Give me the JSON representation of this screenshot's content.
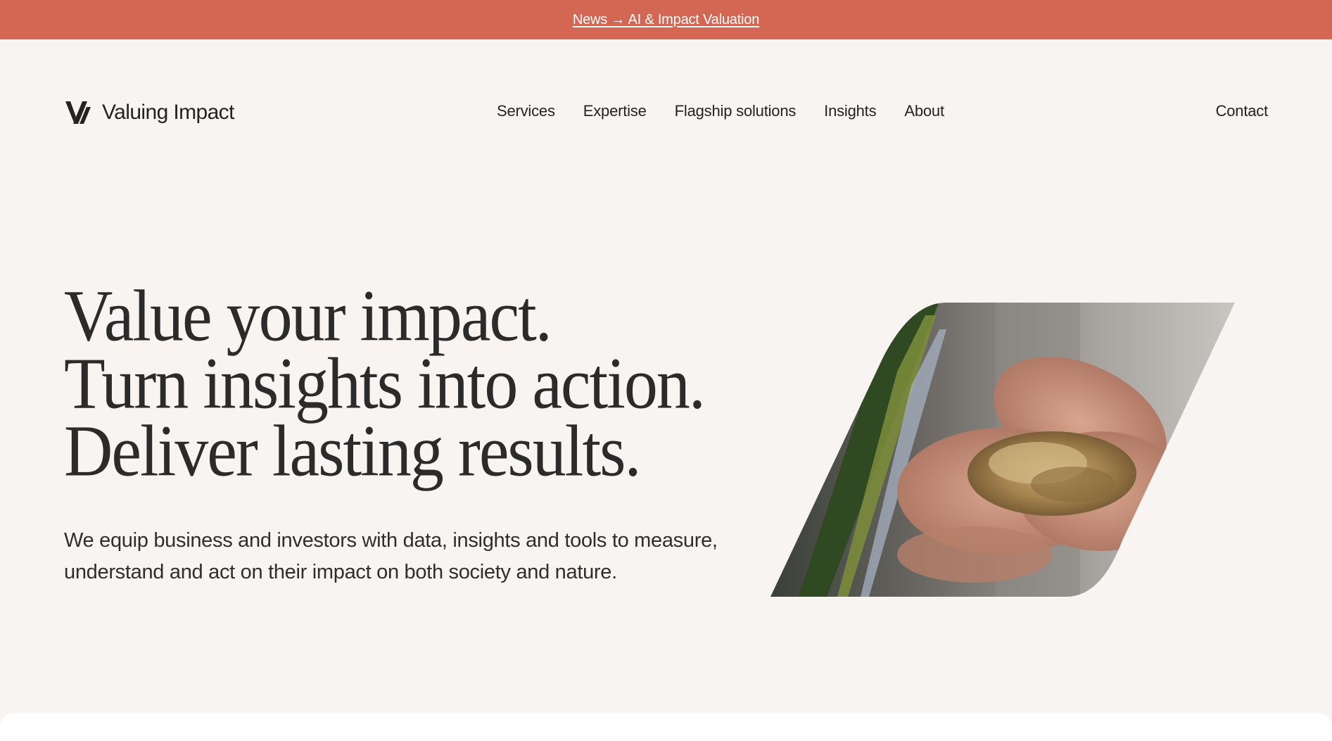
{
  "announcement": {
    "text": "News → AI & Impact Valuation"
  },
  "brand": {
    "name": "Valuing Impact",
    "logo_icon": "vi-monogram-icon"
  },
  "nav": {
    "items": [
      {
        "label": "Services"
      },
      {
        "label": "Expertise"
      },
      {
        "label": "Flagship solutions"
      },
      {
        "label": "Insights"
      },
      {
        "label": "About"
      }
    ],
    "contact_label": "Contact"
  },
  "hero": {
    "title_lines": [
      "Value your impact.",
      "Turn insights into action.",
      "Deliver lasting results."
    ],
    "subtitle": "We equip business and investors with data, insights and tools to measure, understand and act on their impact on both society and nature."
  },
  "colors": {
    "announcement_bg": "#d46754",
    "page_bg": "#f8f4f2",
    "text": "#232323"
  }
}
